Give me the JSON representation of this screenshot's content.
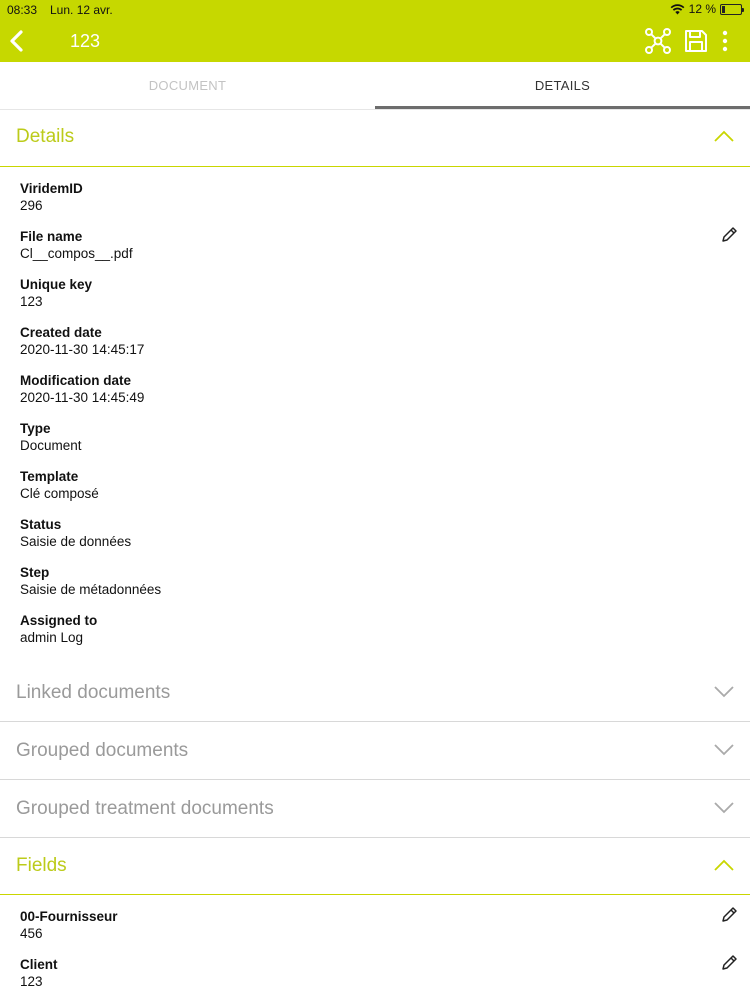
{
  "status_bar": {
    "time": "08:33",
    "date": "Lun. 12 avr.",
    "battery": "12 %",
    "battery_level": 0.12
  },
  "header": {
    "title": "123",
    "accent_color": "#c6d800",
    "icons": [
      "back-icon",
      "network-icon",
      "save-icon",
      "more-icon"
    ]
  },
  "tabs": [
    {
      "label": "DOCUMENT",
      "selected": false
    },
    {
      "label": "DETAILS",
      "selected": true
    }
  ],
  "details_section": {
    "title": "Details",
    "expanded": true,
    "items": [
      {
        "label": "ViridemID",
        "value": "296"
      },
      {
        "label": "File name",
        "value": "Cl__compos__.pdf",
        "editable": true
      },
      {
        "label": "Unique key",
        "value": "123"
      },
      {
        "label": "Created date",
        "value": "2020-11-30 14:45:17"
      },
      {
        "label": "Modification date",
        "value": "2020-11-30 14:45:49"
      },
      {
        "label": "Type",
        "value": "Document"
      },
      {
        "label": "Template",
        "value": "Clé composé"
      },
      {
        "label": "Status",
        "value": "Saisie de données"
      },
      {
        "label": "Step",
        "value": "Saisie de métadonnées"
      },
      {
        "label": "Assigned to",
        "value": "admin Log"
      }
    ]
  },
  "collapsed_sections": [
    {
      "title": "Linked documents",
      "expanded": false
    },
    {
      "title": "Grouped documents",
      "expanded": false
    },
    {
      "title": "Grouped treatment documents",
      "expanded": false
    }
  ],
  "fields_section": {
    "title": "Fields",
    "expanded": true,
    "items": [
      {
        "label": "00-Fournisseur",
        "value": "456",
        "editable": true
      },
      {
        "label": "Client",
        "value": "123",
        "editable": true
      }
    ]
  }
}
